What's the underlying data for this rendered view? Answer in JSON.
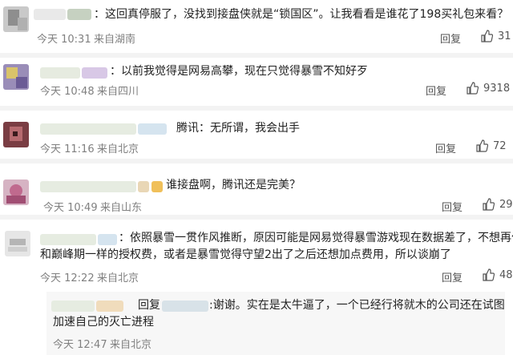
{
  "comments": [
    {
      "text": "：这回真停服了，没找到接盘侠就是“锁国区”。让我看看是谁花了198买礼包来看？",
      "time": "今天 10:31",
      "source": "来自湖南",
      "reply": "回复",
      "likes": "31"
    },
    {
      "text": "：以前我觉得是网易高攀，现在只觉得暴雪不知好歹",
      "time": "今天 10:48",
      "source": "来自四川",
      "reply": "回复",
      "likes": "9318"
    },
    {
      "text": "腾讯：无所谓，我会出手",
      "time": "今天 11:16",
      "source": "来自北京",
      "reply": "回复",
      "likes": "72"
    },
    {
      "text": "谁接盘啊，腾讯还是完美？",
      "time": "今天 10:49",
      "source": "来自山东",
      "reply": "回复",
      "likes": "29"
    },
    {
      "text_line1": "：依照暴雪一贯作风推断，原因可能是网易觉得暴雪游戏现在数据差了，不想再付",
      "text_line2": "和巅峰期一样的授权费，或者是暴雪觉得守望2出了之后还想加点费用，所以谈崩了",
      "time": "今天 12:22",
      "source": "来自北京",
      "reply": "回复",
      "likes": "48",
      "nested": {
        "prefix": "回复",
        "text_line1": ":谢谢。实在是太牛逼了，一个已经行将就木的公司还在试图",
        "text_line2": "加速自己的灭亡进程",
        "time": "今天 12:47",
        "source": "来自北京"
      }
    }
  ]
}
